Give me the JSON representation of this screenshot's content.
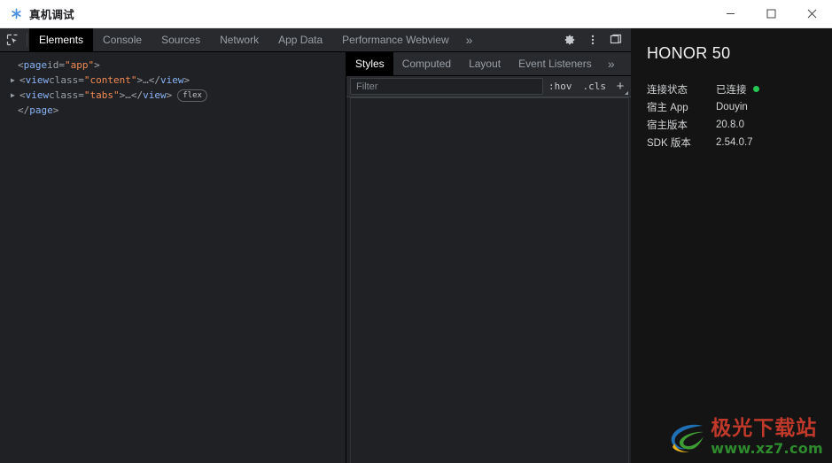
{
  "window": {
    "title": "真机调试",
    "app_icon": "asterisk-icon",
    "controls": {
      "minimize": "minimize-icon",
      "maximize": "maximize-icon",
      "close": "close-icon"
    }
  },
  "devtools": {
    "inspect_icon": "inspect-element-icon",
    "tabs": [
      {
        "label": "Elements",
        "active": true
      },
      {
        "label": "Console",
        "active": false
      },
      {
        "label": "Sources",
        "active": false
      },
      {
        "label": "Network",
        "active": false
      },
      {
        "label": "App Data",
        "active": false
      },
      {
        "label": "Performance Webview",
        "active": false
      }
    ],
    "tabs_overflow": "»",
    "toolbar_icons": [
      {
        "name": "gear-icon"
      },
      {
        "name": "more-vertical-icon"
      },
      {
        "name": "dock-panel-icon"
      }
    ]
  },
  "dom_tree": {
    "lines": [
      {
        "twisty": "",
        "indent": false,
        "parts": [
          {
            "t": "punct",
            "v": "<"
          },
          {
            "t": "tag",
            "v": "page"
          },
          {
            "t": "attr",
            "v": " id"
          },
          {
            "t": "punct",
            "v": "="
          },
          {
            "t": "val",
            "v": "\"app\""
          },
          {
            "t": "punct",
            "v": ">"
          }
        ]
      },
      {
        "twisty": "▶",
        "indent": true,
        "parts": [
          {
            "t": "punct",
            "v": "<"
          },
          {
            "t": "tag",
            "v": "view"
          },
          {
            "t": "attr",
            "v": " class"
          },
          {
            "t": "punct",
            "v": "="
          },
          {
            "t": "val",
            "v": "\"content\""
          },
          {
            "t": "punct",
            "v": ">"
          },
          {
            "t": "ellipsis",
            "v": "…"
          },
          {
            "t": "punct",
            "v": "</"
          },
          {
            "t": "tag",
            "v": "view"
          },
          {
            "t": "punct",
            "v": ">"
          }
        ],
        "badge": ""
      },
      {
        "twisty": "▶",
        "indent": true,
        "parts": [
          {
            "t": "punct",
            "v": "<"
          },
          {
            "t": "tag",
            "v": "view"
          },
          {
            "t": "attr",
            "v": " class"
          },
          {
            "t": "punct",
            "v": "="
          },
          {
            "t": "val",
            "v": "\"tabs\""
          },
          {
            "t": "punct",
            "v": ">"
          },
          {
            "t": "ellipsis",
            "v": "…"
          },
          {
            "t": "punct",
            "v": "</"
          },
          {
            "t": "tag",
            "v": "view"
          },
          {
            "t": "punct",
            "v": ">"
          }
        ],
        "badge": "flex"
      },
      {
        "twisty": "",
        "indent": false,
        "parts": [
          {
            "t": "punct",
            "v": "</"
          },
          {
            "t": "tag",
            "v": "page"
          },
          {
            "t": "punct",
            "v": ">"
          }
        ]
      }
    ]
  },
  "styles_panel": {
    "tabs": [
      {
        "label": "Styles",
        "active": true
      },
      {
        "label": "Computed",
        "active": false
      },
      {
        "label": "Layout",
        "active": false
      },
      {
        "label": "Event Listeners",
        "active": false
      }
    ],
    "tabs_overflow": "»",
    "filter": {
      "value": "",
      "placeholder": "Filter"
    },
    "hov_label": ":hov",
    "cls_label": ".cls",
    "new_rule_label": "+"
  },
  "device_panel": {
    "title": "HONOR 50",
    "rows": [
      {
        "key": "连接状态",
        "value": "已连接",
        "dot": true
      },
      {
        "key": "宿主 App",
        "value": "Douyin",
        "dot": false
      },
      {
        "key": "宿主版本",
        "value": "20.8.0",
        "dot": false
      },
      {
        "key": "SDK 版本",
        "value": "2.54.0.7",
        "dot": false
      }
    ],
    "status_color": "#26c653"
  },
  "watermark": {
    "brand": "极光下载站",
    "url": "www.xz7.com",
    "brand_color": "#c0392b",
    "url_color": "#2e8b2e"
  }
}
